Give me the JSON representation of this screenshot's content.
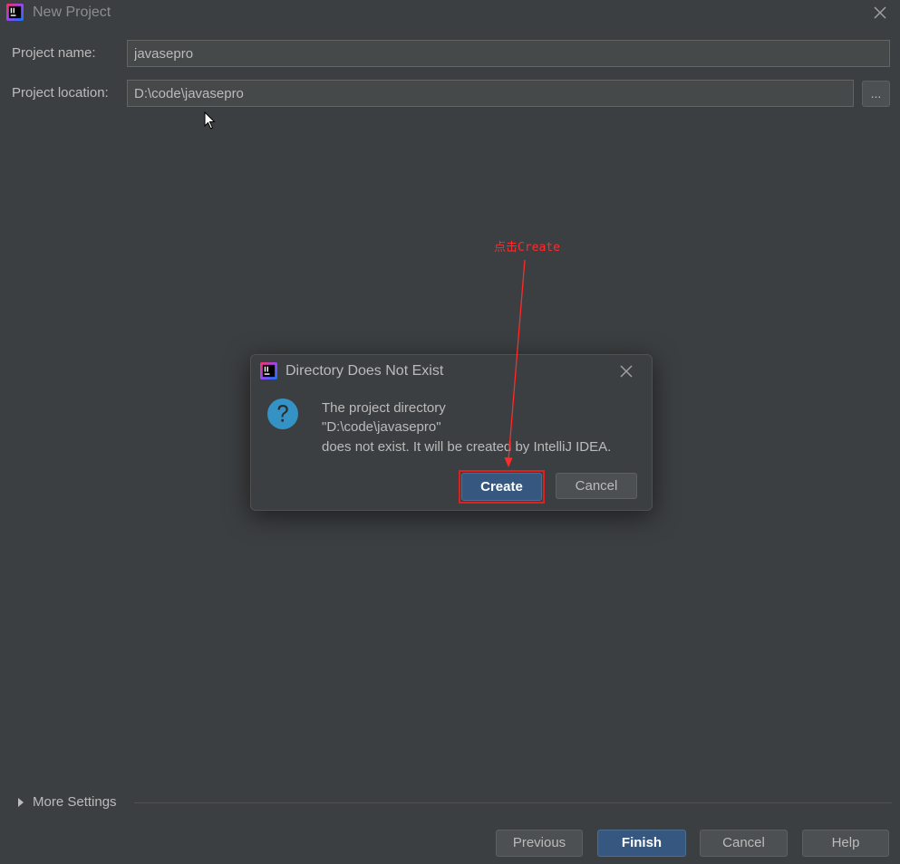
{
  "window": {
    "title": "New Project"
  },
  "form": {
    "project_name_label": "Project name:",
    "project_name_value": "javasepro",
    "project_location_label": "Project location:",
    "project_location_value": "D:\\code\\javasepro",
    "browse_label": "..."
  },
  "dialog": {
    "title": "Directory Does Not Exist",
    "line1": "The project directory",
    "line2": "\"D:\\code\\javasepro\"",
    "line3": "does not exist. It will be created by IntelliJ IDEA.",
    "create_label": "Create",
    "cancel_label": "Cancel"
  },
  "annotation": {
    "text": "点击Create",
    "color": "#ff2a2a"
  },
  "more_settings": {
    "label": "More Settings"
  },
  "footer": {
    "previous_label": "Previous",
    "finish_label": "Finish",
    "cancel_label": "Cancel",
    "help_label": "Help"
  },
  "colors": {
    "background": "#3c3f41",
    "text": "#bbbbbb",
    "primary_button": "#365880",
    "question_icon": "#3592c4",
    "highlight": "#e02020"
  },
  "icons": [
    "intellij-logo-icon",
    "close-icon",
    "question-icon",
    "triangle-right-icon",
    "mouse-cursor-icon"
  ]
}
